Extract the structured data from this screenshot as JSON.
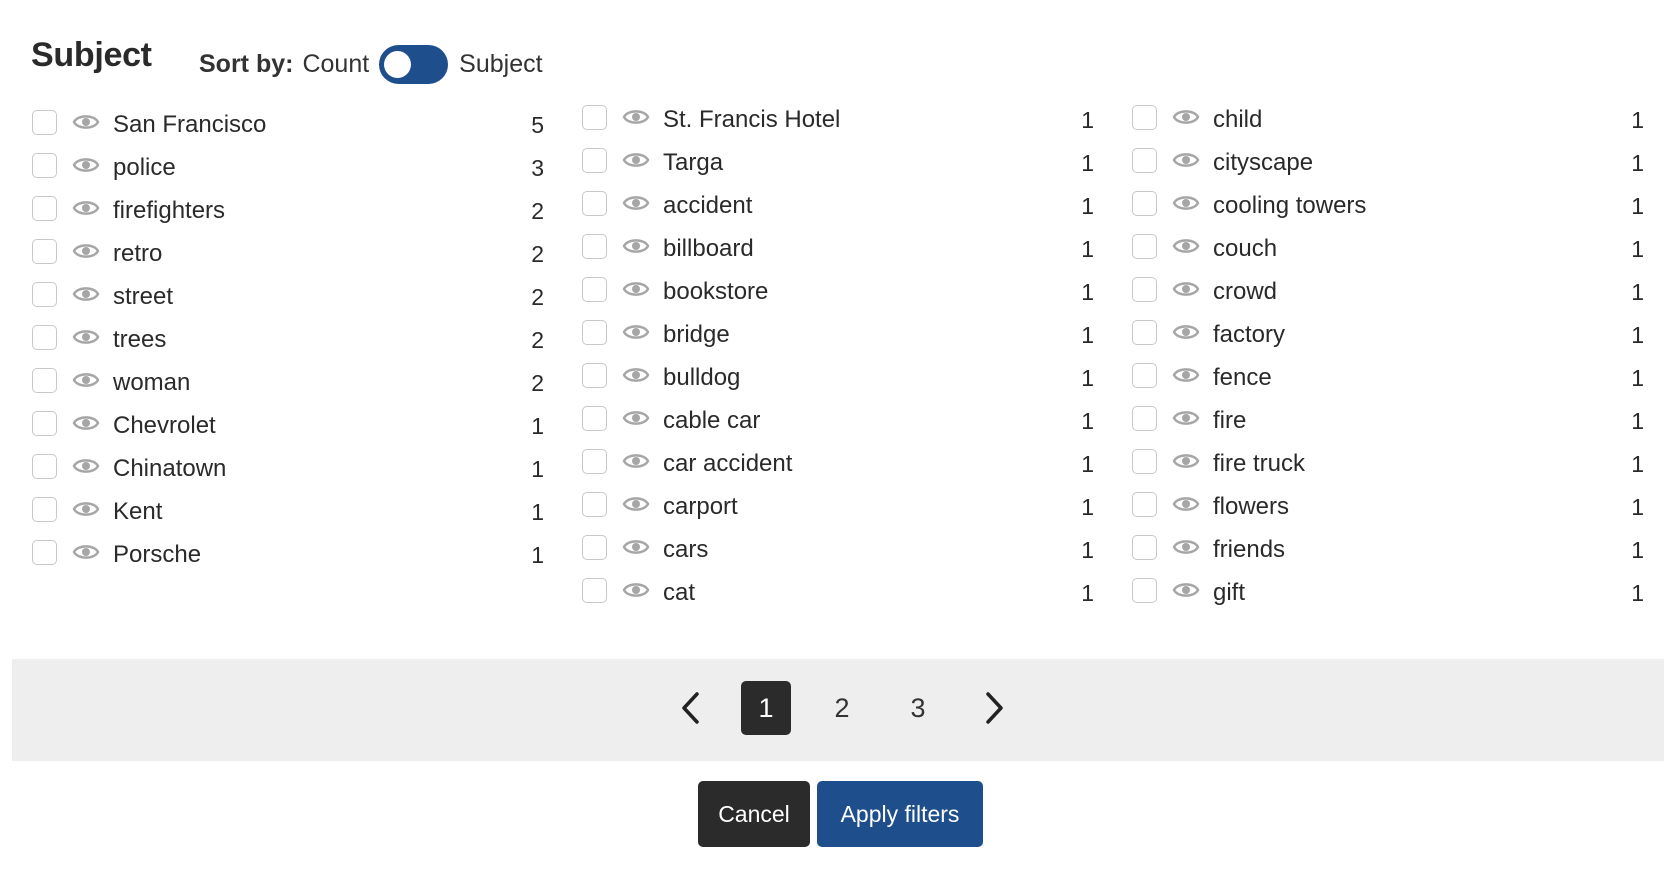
{
  "header": {
    "title": "Subject",
    "sort_label": "Sort by:",
    "sort_option_left": "Count",
    "sort_option_right": "Subject",
    "toggle_state": "Count"
  },
  "columns": [
    [
      {
        "label": "San Francisco",
        "count": "5"
      },
      {
        "label": "police",
        "count": "3"
      },
      {
        "label": "firefighters",
        "count": "2"
      },
      {
        "label": "retro",
        "count": "2"
      },
      {
        "label": "street",
        "count": "2"
      },
      {
        "label": "trees",
        "count": "2"
      },
      {
        "label": "woman",
        "count": "2"
      },
      {
        "label": "Chevrolet",
        "count": "1"
      },
      {
        "label": "Chinatown",
        "count": "1"
      },
      {
        "label": "Kent",
        "count": "1"
      },
      {
        "label": "Porsche",
        "count": "1"
      }
    ],
    [
      {
        "label": "St. Francis Hotel",
        "count": "1"
      },
      {
        "label": "Targa",
        "count": "1"
      },
      {
        "label": "accident",
        "count": "1"
      },
      {
        "label": "billboard",
        "count": "1"
      },
      {
        "label": "bookstore",
        "count": "1"
      },
      {
        "label": "bridge",
        "count": "1"
      },
      {
        "label": "bulldog",
        "count": "1"
      },
      {
        "label": "cable car",
        "count": "1"
      },
      {
        "label": "car accident",
        "count": "1"
      },
      {
        "label": "carport",
        "count": "1"
      },
      {
        "label": "cars",
        "count": "1"
      },
      {
        "label": "cat",
        "count": "1"
      }
    ],
    [
      {
        "label": "child",
        "count": "1"
      },
      {
        "label": "cityscape",
        "count": "1"
      },
      {
        "label": "cooling towers",
        "count": "1"
      },
      {
        "label": "couch",
        "count": "1"
      },
      {
        "label": "crowd",
        "count": "1"
      },
      {
        "label": "factory",
        "count": "1"
      },
      {
        "label": "fence",
        "count": "1"
      },
      {
        "label": "fire",
        "count": "1"
      },
      {
        "label": "fire truck",
        "count": "1"
      },
      {
        "label": "flowers",
        "count": "1"
      },
      {
        "label": "friends",
        "count": "1"
      },
      {
        "label": "gift",
        "count": "1"
      }
    ]
  ],
  "pagination": {
    "pages": [
      "1",
      "2",
      "3"
    ],
    "current": "1"
  },
  "footer": {
    "cancel_label": "Cancel",
    "apply_label": "Apply filters"
  },
  "icons": {
    "row_icon": "eye-icon",
    "prev": "chevron-left-icon",
    "next": "chevron-right-icon"
  },
  "colors": {
    "accent": "#1e4e8c",
    "dark_button": "#2b2b2b",
    "pager_band": "#eeeeee",
    "eye_icon": "#a6a6a6"
  }
}
